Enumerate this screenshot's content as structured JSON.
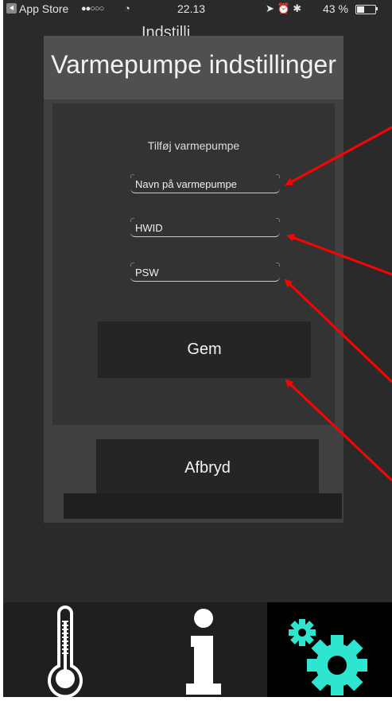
{
  "status_bar": {
    "carrier": "App Store",
    "signal": "●●○○○",
    "wifi_icon": "wifi-icon",
    "time": "22.13",
    "battery_text": "43 %",
    "battery_level": 0.43
  },
  "background": {
    "title_fragment": "Indstilli"
  },
  "dialog": {
    "title": "Varmepumpe indstillinger",
    "section_label": "Tilføj varmepumpe",
    "fields": {
      "name": {
        "placeholder": "Navn på varmepumpe",
        "value": ""
      },
      "hwid": {
        "placeholder": "HWID",
        "value": ""
      },
      "psw": {
        "placeholder": "PSW",
        "value": ""
      }
    },
    "save_label": "Gem",
    "cancel_label": "Afbryd"
  },
  "tabbar": {
    "tabs": [
      {
        "icon": "thermometer-icon",
        "active": false
      },
      {
        "icon": "info-icon",
        "active": false
      },
      {
        "icon": "gears-icon",
        "active": true
      }
    ],
    "active_color": "#2ee6cf"
  },
  "annotation_color": "#ff0000"
}
